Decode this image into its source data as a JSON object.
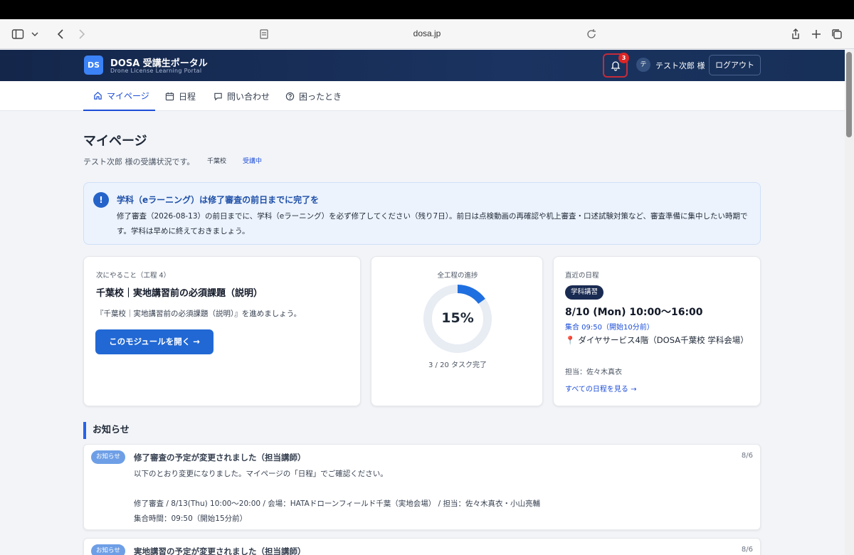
{
  "browser": {
    "url": "dosa.jp"
  },
  "header": {
    "logo": "DS",
    "title": "DOSA 受講生ポータル",
    "subtitle": "Drone License Learning Portal",
    "notifications_count": "3",
    "user_avatar": "テ",
    "user_name": "テスト次郎 様",
    "logout_label": "ログアウト"
  },
  "nav": {
    "tabs": [
      {
        "label": "マイページ",
        "icon": "home-icon",
        "active": true
      },
      {
        "label": "日程",
        "icon": "calendar-icon",
        "active": false
      },
      {
        "label": "問い合わせ",
        "icon": "chat-icon",
        "active": false
      },
      {
        "label": "困ったとき",
        "icon": "help-icon",
        "active": false
      }
    ]
  },
  "page": {
    "title": "マイページ",
    "description": "テスト次郎 様の受講状況です。",
    "school_tag": "千葉校",
    "status_tag": "受講中"
  },
  "alert": {
    "icon": "!",
    "title": "学科（eラーニング）は修了審査の前日までに完了を",
    "body": "修了審査（2026-08-13）の前日までに、学科（eラーニング）を必ず修了してください（残り7日）。前日は点検動画の再確認や机上審査・口述試験対策など、審査準備に集中したい時期です。学科は早めに終えておきましょう。"
  },
  "next_task": {
    "label": "次にやること（工程 4）",
    "title": "千葉校｜実地講習前の必須課題（説明）",
    "text": "『千葉校｜実地講習前の必須課題（説明）』を進めましょう。",
    "button": "このモジュールを開く →"
  },
  "progress": {
    "label": "全工程の進捗",
    "percent_text": "15%",
    "fraction": 0.15,
    "caption": "3 / 20 タスク完了",
    "accent": "#1f6fe0",
    "track": "#e8ecf3"
  },
  "schedule": {
    "label": "直近の日程",
    "badge": "学科講習",
    "date": "8/10 (Mon) 10:00〜16:00",
    "gather": "集合 09:50（開始10分前）",
    "place": "ダイヤサービス4階（DOSA千葉校 学科会場）",
    "teacher": "担当：佐々木真衣",
    "link": "すべての日程を見る →"
  },
  "news": {
    "section_title": "お知らせ",
    "items": [
      {
        "badge": "お知らせ",
        "title": "修了審査の予定が変更されました（担当講師）",
        "date": "8/6",
        "body": "以下のとおり変更になりました。マイページの「日程」でご確認ください。\n\n修了審査 / 8/13(Thu) 10:00〜20:00 / 会場：HATAドローンフィールド千葉（実地会場） / 担当：佐々木真衣・小山亮輔\n集合時間：09:50（開始15分前）"
      },
      {
        "badge": "お知らせ",
        "title": "実地講習の予定が変更されました（担当講師）",
        "date": "8/6",
        "body": ""
      }
    ]
  }
}
